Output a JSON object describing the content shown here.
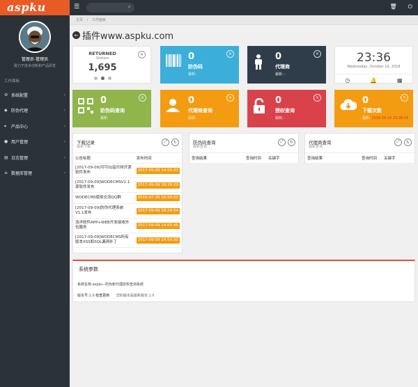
{
  "brand": {
    "logo": "aspku"
  },
  "profile": {
    "name": "管理员-管理员",
    "desc": "致力于技术创新和产品研发"
  },
  "sidebar": {
    "section_title": "工作面板",
    "items": [
      {
        "label": "系统配置",
        "icon": "gear-icon"
      },
      {
        "label": "防伪代理",
        "icon": "shield-icon"
      },
      {
        "label": "产品中心",
        "icon": "cart-icon"
      },
      {
        "label": "用户管理",
        "icon": "user-icon"
      },
      {
        "label": "日志管理",
        "icon": "doc-icon"
      },
      {
        "label": "数据库管理",
        "icon": "database-icon"
      }
    ]
  },
  "topbar": {
    "menu_icon": "hamburger-icon",
    "search_icon": "search-icon",
    "right_icons": [
      "trash-icon",
      "power-icon"
    ]
  },
  "breadcrumb": {
    "home": "主页",
    "sep": "/",
    "current": "工作面板"
  },
  "page": {
    "title": "插件www.aspku.com"
  },
  "tiles": {
    "returned": {
      "title": "RETURNED",
      "subtitle": "Visitors",
      "value": "1,695"
    },
    "fangwei": {
      "num": "0",
      "label": "防伪码",
      "sub": "最新: ",
      "color": "#3bafda"
    },
    "daili": {
      "num": "0",
      "label": "代理商",
      "sub": "最新: -",
      "color": "#2f3d4a"
    },
    "clock": {
      "time": "23:36",
      "date": "Wednesday, October 10, 2018"
    },
    "fwcx": {
      "num": "0",
      "label": "防伪码查询",
      "sub": "最新: ",
      "color": "#8fb54b"
    },
    "dlcx": {
      "num": "0",
      "label": "代理商查询",
      "sub": "最新: ",
      "color": "#f39c12"
    },
    "sqcx": {
      "num": "0",
      "label": "授权查询",
      "sub": "最新: -",
      "color": "#d9424a"
    },
    "xzcs": {
      "num": "0",
      "label": "下载次数",
      "sub_prefix": "最新: ",
      "sub_red": "2018-10-10 23:36:55",
      "color": "#f39c12"
    }
  },
  "download_panel": {
    "title": "下载记录",
    "subtitle": "最新下载",
    "headers": [
      "公告标题",
      "发布时间"
    ],
    "rows": [
      {
        "title": "[2017-09-09]可可DJ音乐网开源软件发布",
        "time": "2017-09-09 14:55:33"
      },
      {
        "title": "[2017-09-09]WODECMSV1.1源软件发布",
        "time": "2017-09-09 18:26:29"
      },
      {
        "title": "WODECMS使用交流QQ群",
        "time": "2016-07-26 10:54:02"
      },
      {
        "title": "[2017-09-09]防伪代理系统V1.1发布",
        "time": "2017-09-09 18:24:54"
      },
      {
        "title": "浩洋软件APP+WEB开发接收外包服务",
        "time": "2017-09-09 14:55:45"
      },
      {
        "title": "[2017-09-09]WODECMS所有版本XSS和SQL漏洞补丁",
        "time": "2017-09-09 14:50:30"
      }
    ]
  },
  "fangwei_panel": {
    "title": "防伪码查询",
    "subtitle": "最新查询",
    "headers": [
      "查询结果",
      "查询时间",
      "关键字"
    ]
  },
  "daili_panel": {
    "title": "代理商查询",
    "subtitle": "最新查询",
    "headers": [
      "查询结果",
      "查询时间",
      "关键字"
    ]
  },
  "system": {
    "title": "系统参数",
    "name_line": "系统名称:aspku--防伪和代理授权查询系统",
    "version": "版本号:1.0",
    "update": "检查更新",
    "status": "您的版本是最新版本:1.0"
  }
}
